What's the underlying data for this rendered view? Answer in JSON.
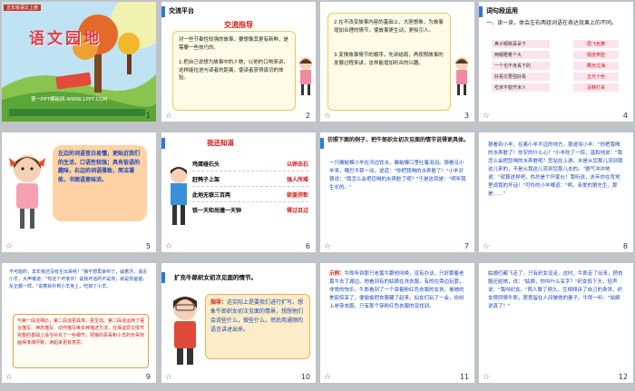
{
  "slides": [
    {
      "num": "1",
      "cover_badge": "五年级语文上册",
      "cover_title": "语文园地",
      "cover_url": "第一PPT模板网-WWW.1PPT.COM"
    },
    {
      "num": "2",
      "header": "交流平台",
      "title": "交流指导",
      "body": "对一些节奏性较强的故事，要想像其更有新鲜，是需要一些技巧的。",
      "point1": "1.把自己说想为故事中的人物，以他的口吻来讲，这样能拉进与读者的距离，使读者获得真切的体验。"
    },
    {
      "num": "3",
      "point2": "2.在不改变故事内容的基础上，大胆想象，为故事增加合理的情节，使故事更生动，更吸引人。",
      "point3": "3.变换故事情节的顺序，先讲结局，再按照故事的发展过程来讲，这样能增加听众的兴趣。"
    },
    {
      "num": "4",
      "header": "词句段运用",
      "instruction": "一、读一读，体会左右两组词语在表达效果上的不同。",
      "rows": [
        {
          "left": "鼻子眼睛耳朵下",
          "right": "眉飞色舞"
        },
        {
          "left": "两眼瞪着个大",
          "right": "嬉皮笑脸"
        },
        {
          "left": "一个也不肯丢下的",
          "right": "瞒天过海"
        },
        {
          "left": "好看又要强好看",
          "right": "五光十色"
        },
        {
          "left": "吃米不能开米人",
          "right": "没精打采"
        }
      ]
    },
    {
      "num": "5",
      "bubble": "左边的词语音白易懂，更贴近我们的生活，口语性较强；具有俗语的趣味，右边的词语雅致，简洁凝练，书面语意味浓。"
    },
    {
      "num": "6",
      "header": "我还知道",
      "rows": [
        {
          "left": "鸡蛋碰石头",
          "right": "以卵击石"
        },
        {
          "left": "赶鸭子上架",
          "right": "强人所难"
        },
        {
          "left": "此地无银三百两",
          "right": "欲盖弥彰"
        },
        {
          "left": "铁一天和尚撞一天钟",
          "right": "得过且过"
        }
      ]
    },
    {
      "num": "7",
      "prompt": "仿照下面的例子，把牛郎织女初次见面的情节说得更具体。",
      "example": "一只癞蛤蟆小羊在河边饮水，癞蛤蟆口里吐着泡泡。狼看见小羊来，嘴巴不禁一动，说道：\"你把我喝的水弄脏了！\"小羊对狼说：\"我怎么会把您喝的水弄脏了呢？\"于是这就是：\"明年我生长的。\""
    },
    {
      "num": "8",
      "story": "狼看到小羊，在离小羊不远的地方，狼谩骂小羊：\"你把我喝的水弄脏了！你安的什么心？\"小羊吃了一惊，温和地说：\"我怎么会把您喝的水弄脏呢？您站在上游，水是从您那儿流到我这儿来的，不是从我这儿流到您那儿去的。\"狼气冲冲地说：\"就算这样吧，你总是个坏家伙！我听说，去年你在背地里说我的坏话！\"可怜的小羊喊道：\"啊，亲爱的狼先生，那是……\""
    },
    {
      "num": "9",
      "story": "不可能的，去年我还没有生出来呢！\"狼不想再争辩了，龇着牙，逼近小羊，大声嚷道：\"你这个坏家伙！说我坏话的不是你，就是你爸爸，反正都一样。\"说着就扑到小羊身上，吃掉了小羊。",
      "note": "与第一段话相比，第二段话更具体，更生动。第二段话运用了语言描写、神态描写、动作描写等多种描述方法，在保证原文情节完整的基础上适当补充了一些细节，把狼的恶毒和小羊的无辜刻画得淋漓尽致，读起来更有意思。"
    },
    {
      "num": "10",
      "title": "扩充牛郎织女初次见面的情节。",
      "guide_label": "指导：",
      "guide": "这实际上是要我们进行扩写。想象牛郎织女初次见面的情景，想想他们会说些什么，做些什么，然后用通顺的语言讲述出来。"
    },
    {
      "num": "11",
      "example_label": "示例：",
      "story": "牛郎听到那只老黄牛跟他叫唤，没有办法，只好跟着老黄牛去了湖边。他看到有的姑娘在洗衣服，有的在旁边玩耍，非常的快乐。牛郎看到了一个穿着粉红色衣服的女孩，被她的美丽惊呆了，便偷偷把衣服藏了起来。仙女们玩了一会，纷纷上岸穿衣服，只有那个穿粉红色衣服的没找到。"
    },
    {
      "num": "12",
      "story": "姑娘们都飞走了，只有织女没走。这时，牛郎走了出来，把衣服还给她，说：\"姑娘，你叫什么名字？\"织女低下头，轻声说：\"我叫织女。\"两人聊了很久，互相倾诉了自己的身世，织女很同情牛郎，愿意留在人间做他的妻子。牛郎一听：\"姑娘说真了！\""
    }
  ],
  "colors": {
    "accent_blue": "#2b7ad8",
    "accent_red": "#d01818",
    "bubble_orange": "#ffd2a6",
    "grid": "#bfc4c9"
  }
}
